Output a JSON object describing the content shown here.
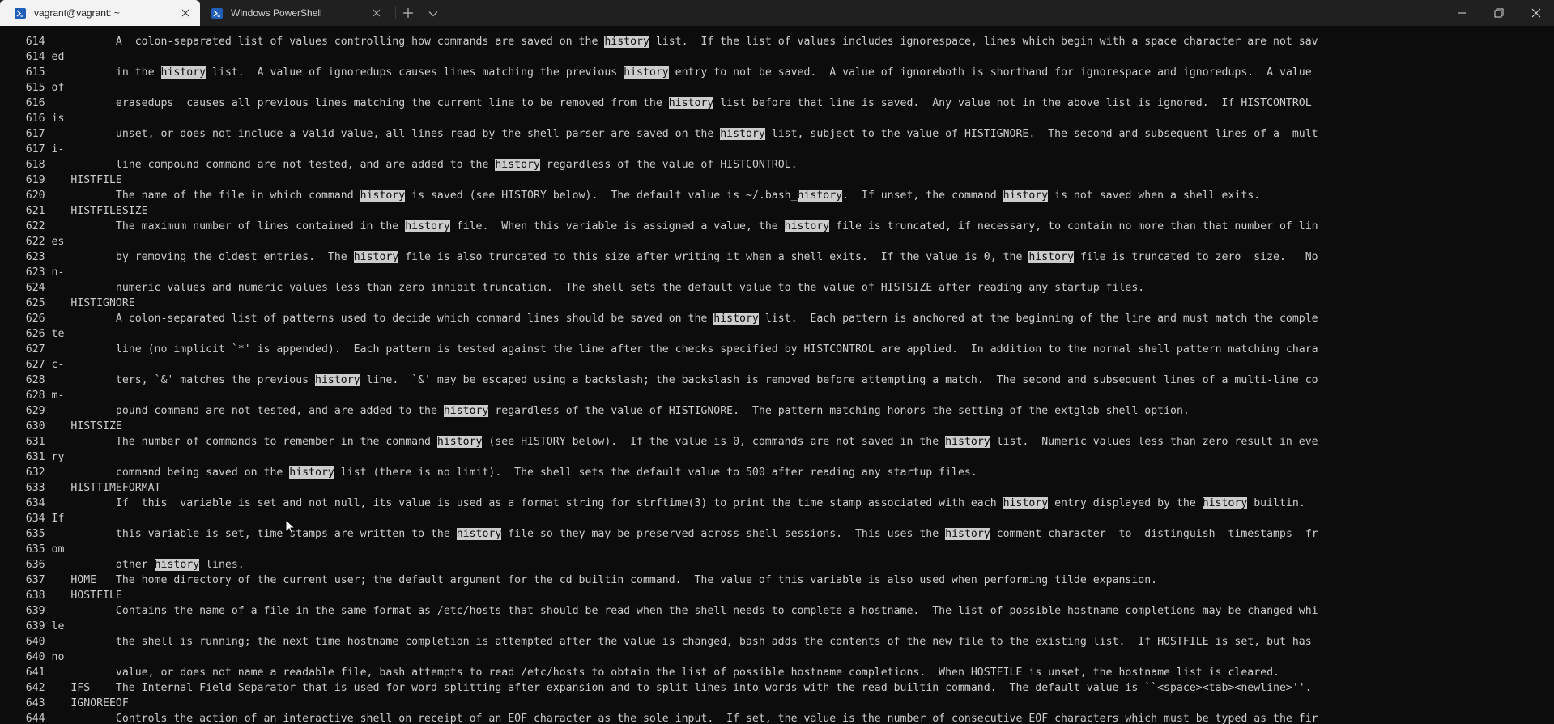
{
  "tabs": [
    {
      "label": "vagrant@vagrant: ~",
      "icon": "powershell-icon",
      "active": true
    },
    {
      "label": "Windows PowerShell",
      "icon": "powershell-icon",
      "active": false
    }
  ],
  "window_controls": [
    "minimize-icon",
    "restore-icon",
    "close-icon"
  ],
  "colors": {
    "background": "#0c0c0c",
    "foreground": "#cccccc",
    "highlight_bg": "#cccccc",
    "tabbar": "#202020",
    "active_tab": "#f3f3f3"
  },
  "highlight_term": "history",
  "terminal_lines": [
    "    614           A  colon-separated list of values controlling how commands are saved on the history list.  If the list of values includes ignorespace, lines which begin with a space character are not sav",
    "    614 ed",
    "    615           in the history list.  A value of ignoredups causes lines matching the previous history entry to not be saved.  A value of ignoreboth is shorthand for ignorespace and ignoredups.  A value",
    "    615 of",
    "    616           erasedups  causes all previous lines matching the current line to be removed from the history list before that line is saved.  Any value not in the above list is ignored.  If HISTCONTROL",
    "    616 is",
    "    617           unset, or does not include a valid value, all lines read by the shell parser are saved on the history list, subject to the value of HISTIGNORE.  The second and subsequent lines of a  mult",
    "    617 i-",
    "    618           line compound command are not tested, and are added to the history regardless of the value of HISTCONTROL.",
    "    619    HISTFILE",
    "    620           The name of the file in which command history is saved (see HISTORY below).  The default value is ~/.bash_history.  If unset, the command history is not saved when a shell exits.",
    "    621    HISTFILESIZE",
    "    622           The maximum number of lines contained in the history file.  When this variable is assigned a value, the history file is truncated, if necessary, to contain no more than that number of lin",
    "    622 es",
    "    623           by removing the oldest entries.  The history file is also truncated to this size after writing it when a shell exits.  If the value is 0, the history file is truncated to zero  size.   No",
    "    623 n-",
    "    624           numeric values and numeric values less than zero inhibit truncation.  The shell sets the default value to the value of HISTSIZE after reading any startup files.",
    "    625    HISTIGNORE",
    "    626           A colon-separated list of patterns used to decide which command lines should be saved on the history list.  Each pattern is anchored at the beginning of the line and must match the comple",
    "    626 te",
    "    627           line (no implicit `*' is appended).  Each pattern is tested against the line after the checks specified by HISTCONTROL are applied.  In addition to the normal shell pattern matching chara",
    "    627 c-",
    "    628           ters, `&' matches the previous history line.  `&' may be escaped using a backslash; the backslash is removed before attempting a match.  The second and subsequent lines of a multi-line co",
    "    628 m-",
    "    629           pound command are not tested, and are added to the history regardless of the value of HISTIGNORE.  The pattern matching honors the setting of the extglob shell option.",
    "    630    HISTSIZE",
    "    631           The number of commands to remember in the command history (see HISTORY below).  If the value is 0, commands are not saved in the history list.  Numeric values less than zero result in eve",
    "    631 ry",
    "    632           command being saved on the history list (there is no limit).  The shell sets the default value to 500 after reading any startup files.",
    "    633    HISTTIMEFORMAT",
    "    634           If  this  variable is set and not null, its value is used as a format string for strftime(3) to print the time stamp associated with each history entry displayed by the history builtin.",
    "    634 If",
    "    635           this variable is set, time stamps are written to the history file so they may be preserved across shell sessions.  This uses the history comment character  to  distinguish  timestamps  fr",
    "    635 om",
    "    636           other history lines.",
    "    637    HOME   The home directory of the current user; the default argument for the cd builtin command.  The value of this variable is also used when performing tilde expansion.",
    "    638    HOSTFILE",
    "    639           Contains the name of a file in the same format as /etc/hosts that should be read when the shell needs to complete a hostname.  The list of possible hostname completions may be changed whi",
    "    639 le",
    "    640           the shell is running; the next time hostname completion is attempted after the value is changed, bash adds the contents of the new file to the existing list.  If HOSTFILE is set, but has",
    "    640 no",
    "    641           value, or does not name a readable file, bash attempts to read /etc/hosts to obtain the list of possible hostname completions.  When HOSTFILE is unset, the hostname list is cleared.",
    "    642    IFS    The Internal Field Separator that is used for word splitting after expansion and to split lines into words with the read builtin command.  The default value is ``<space><tab><newline>''.",
    "    643    IGNOREEOF",
    "    644           Controls the action of an interactive shell on receipt of an EOF character as the sole input.  If set, the value is the number of consecutive EOF characters which must be typed as the fir"
  ]
}
